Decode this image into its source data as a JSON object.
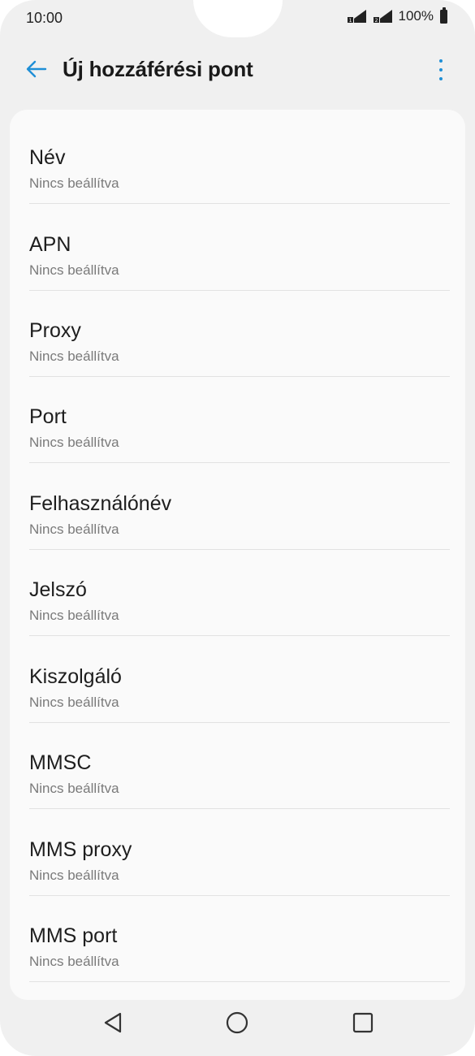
{
  "status": {
    "time": "10:00",
    "battery": "100%"
  },
  "appbar": {
    "title": "Új hozzáférési pont",
    "back_icon": "arrow-left-icon",
    "menu_icon": "more-vert-icon",
    "accent": "#1f8fd6"
  },
  "settings": [
    {
      "label": "Név",
      "value": "Nincs beállítva"
    },
    {
      "label": "APN",
      "value": "Nincs beállítva"
    },
    {
      "label": "Proxy",
      "value": "Nincs beállítva"
    },
    {
      "label": "Port",
      "value": "Nincs beállítva"
    },
    {
      "label": "Felhasználónév",
      "value": "Nincs beállítva"
    },
    {
      "label": "Jelszó",
      "value": "Nincs beállítva"
    },
    {
      "label": "Kiszolgáló",
      "value": "Nincs beállítva"
    },
    {
      "label": "MMSC",
      "value": "Nincs beállítva"
    },
    {
      "label": "MMS proxy",
      "value": "Nincs beállítva"
    },
    {
      "label": "MMS port",
      "value": "Nincs beállítva"
    }
  ],
  "navbar": {
    "back_icon": "nav-back-triangle-icon",
    "home_icon": "nav-home-circle-icon",
    "recents_icon": "nav-recents-square-icon"
  }
}
